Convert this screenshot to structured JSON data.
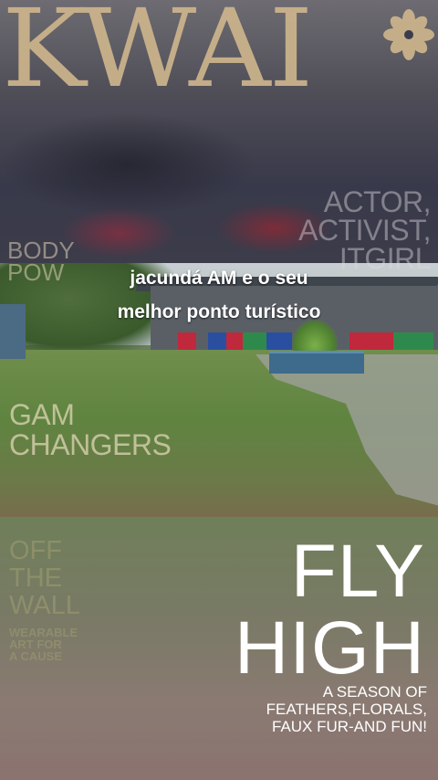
{
  "magazine": {
    "brand": "KWAI",
    "brand_mark": "asterisk-flower-icon",
    "cover_lines": {
      "actor": [
        "ACTOR,",
        "ACTIVIST,",
        "ITGIRL"
      ],
      "body_power": [
        "BODY",
        "POW"
      ],
      "game_changers": [
        "GAM",
        "CHANGERS"
      ],
      "off_the_wall": [
        "OFF",
        "THE",
        "WALL"
      ],
      "wearable": [
        "WEARABLE",
        "ART FOR",
        "A CAUSE"
      ],
      "headline": [
        "FLY",
        "HIGH"
      ],
      "season": [
        "A SEASON OF",
        "FEATHERS,FLORALS,",
        "FAUX FUR-AND FUN!"
      ]
    }
  },
  "caption": {
    "line1": "jacundá AM e o seu",
    "line2": "melhor ponto turístico"
  },
  "colors": {
    "brand_gold": "#cdb58c",
    "caption_text": "#ffffff"
  }
}
